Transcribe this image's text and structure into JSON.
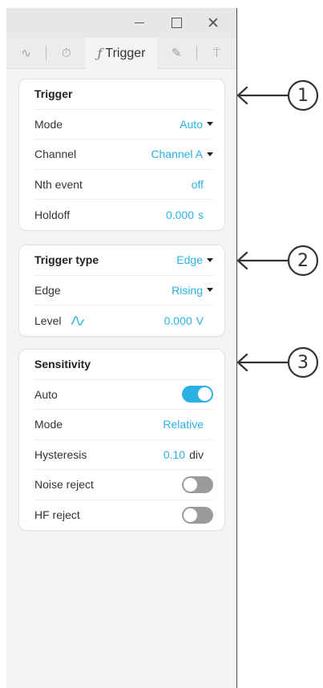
{
  "window": {
    "controls": {
      "minimize_icon": "minimize-icon",
      "maximize_icon": "maximize-icon",
      "close_icon": "close-icon",
      "close_glyph": "✕"
    }
  },
  "tabs": {
    "waveform_glyph": "∿",
    "timer_glyph": "⏱",
    "trigger_glyph": "ƒ",
    "trigger_label": "Trigger",
    "pen_glyph": "✎",
    "probe_glyph": "⍑"
  },
  "trigger": {
    "title": "Trigger",
    "mode_label": "Mode",
    "mode_value": "Auto",
    "channel_label": "Channel",
    "channel_value": "Channel A",
    "nth_label": "Nth event",
    "nth_value": "off",
    "holdoff_label": "Holdoff",
    "holdoff_value": "0.000",
    "holdoff_unit": "s"
  },
  "trigger_type": {
    "title": "Trigger type",
    "type_value": "Edge",
    "edge_label": "Edge",
    "edge_value": "Rising",
    "level_label": "Level",
    "level_value": "0.000",
    "level_unit": "V"
  },
  "sensitivity": {
    "title": "Sensitivity",
    "auto_label": "Auto",
    "auto_on": true,
    "mode_label": "Mode",
    "mode_value": "Relative",
    "hysteresis_label": "Hysteresis",
    "hysteresis_value": "0.10",
    "hysteresis_unit": "div",
    "noise_label": "Noise reject",
    "noise_on": false,
    "hf_label": "HF reject",
    "hf_on": false
  },
  "callouts": [
    "1",
    "2",
    "3"
  ],
  "colors": {
    "accent": "#2bb1e3",
    "toggle_off": "#9b9b9b"
  }
}
